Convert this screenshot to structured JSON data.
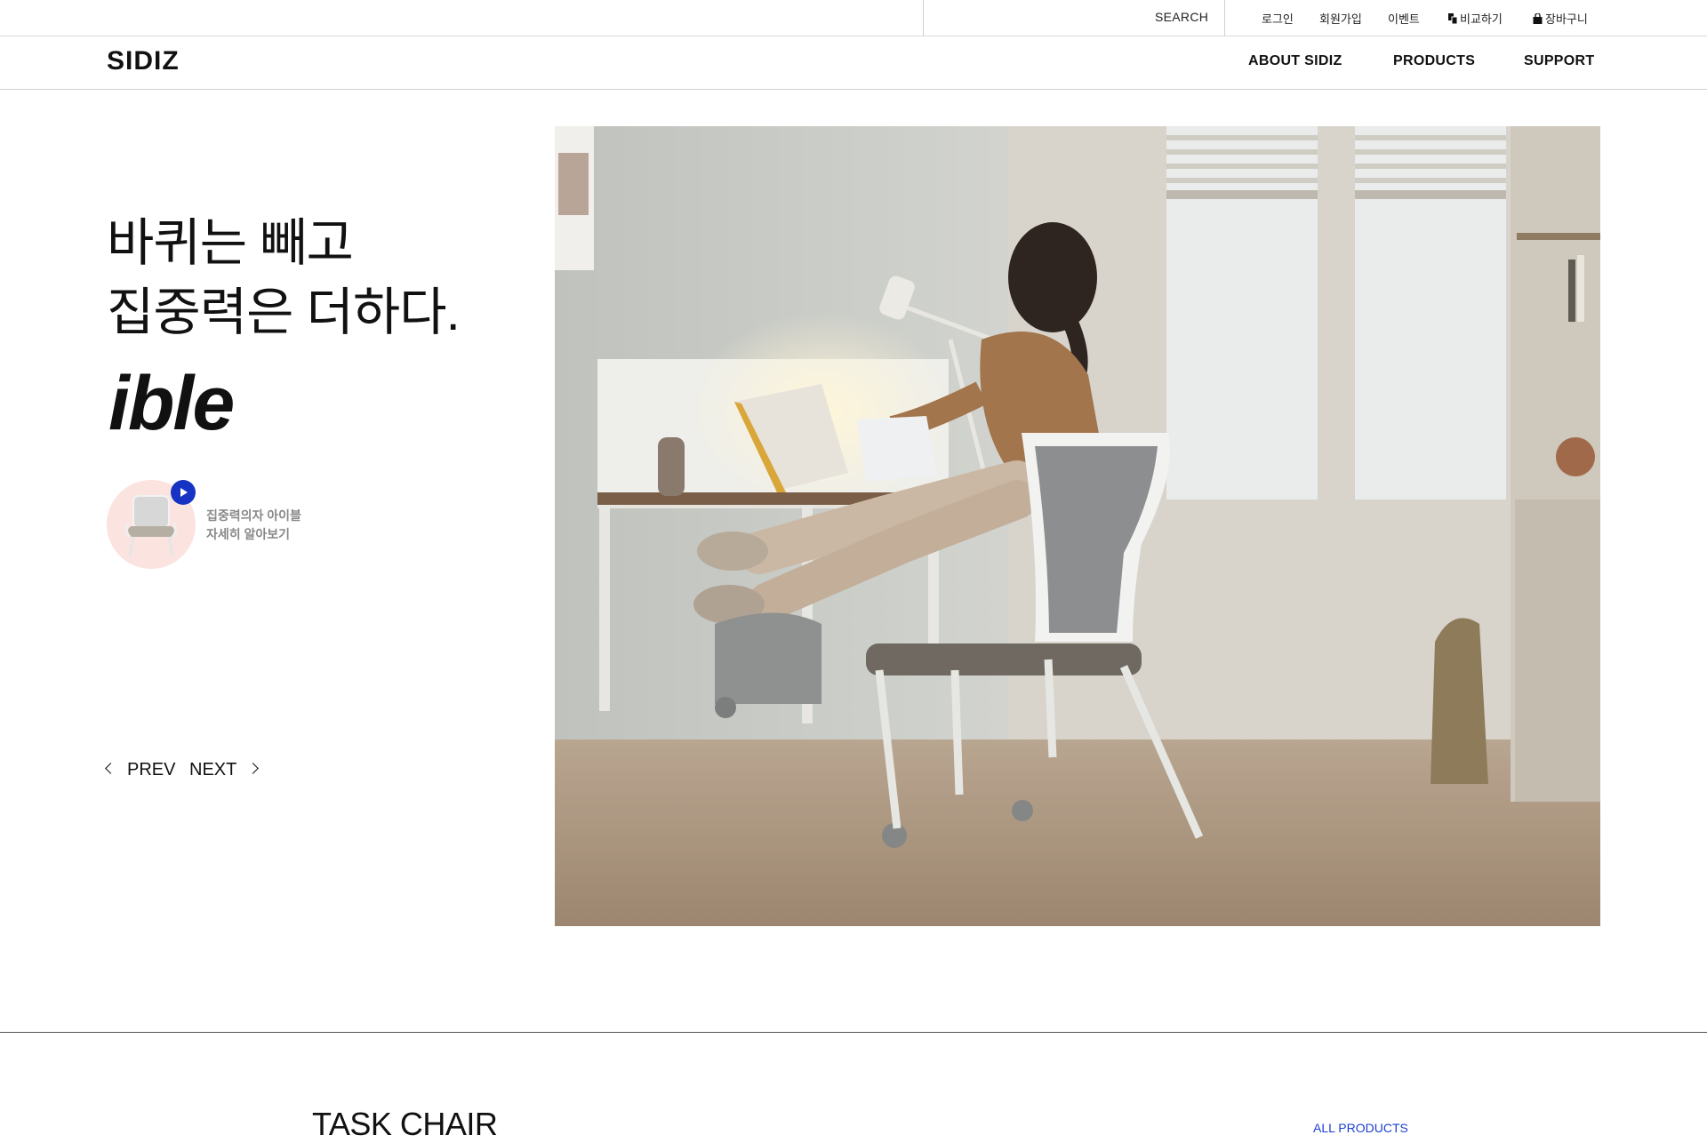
{
  "topbar": {
    "search_label": "SEARCH",
    "login": "로그인",
    "signup": "회원가입",
    "event": "이벤트",
    "compare": "비교하기",
    "cart": "장바구니"
  },
  "nav": {
    "logo": "SIDIZ",
    "menu": [
      "ABOUT SIDIZ",
      "PRODUCTS",
      "SUPPORT"
    ]
  },
  "hero": {
    "title_line1": "바퀴는 빼고",
    "title_line2": "집중력은 더하다.",
    "subtitle": "ible",
    "promo_line1": "집중력의자 아이블",
    "promo_line2": "자세히 알아보기",
    "prev_label": "PREV",
    "next_label": "NEXT"
  },
  "section": {
    "title": "TASK CHAIR",
    "all_products": "ALL PRODUCTS"
  },
  "colors": {
    "accent_blue": "#1633c4",
    "link_blue": "#1c3fd0",
    "promo_pink": "#fbe3df"
  },
  "icons": {
    "compare": "compare-icon",
    "cart": "cart-icon",
    "play": "play-icon",
    "prev": "chevron-left-icon",
    "next": "chevron-right-icon"
  }
}
